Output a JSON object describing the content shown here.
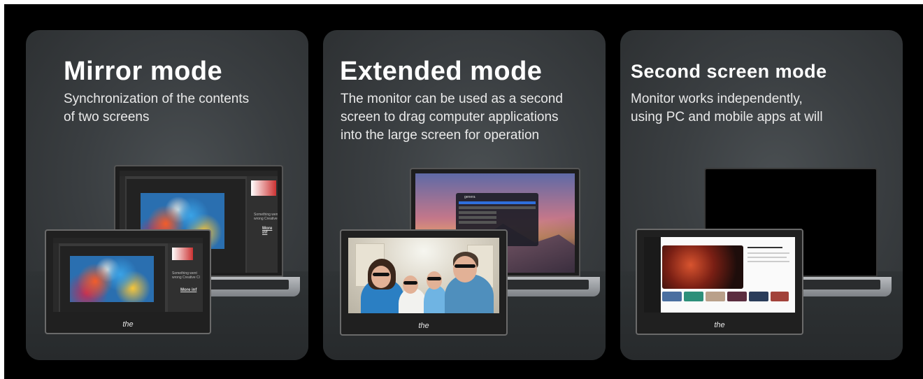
{
  "panels": [
    {
      "title": "Mirror mode",
      "description_line1": "Synchronization of the contents",
      "description_line2": "of two screens",
      "laptop_link": "More inf",
      "monitor_link": "More inf",
      "ps_hint": "Something went wrong Creative Cl",
      "monitor_brand": "the"
    },
    {
      "title": "Extended mode",
      "description_line1": "The monitor can be used as a second",
      "description_line2": "screen to drag computer applications",
      "description_line3": "into the large screen for operation",
      "spotlight_query": "genera",
      "monitor_brand": "the"
    },
    {
      "title": "Second screen mode",
      "description_line1": "Monitor works independently,",
      "description_line2": "using PC and mobile apps at will",
      "monitor_brand": "the"
    }
  ],
  "colors": {
    "background": "#000000",
    "panel": "#3a3e41",
    "title": "#ffffff",
    "description": "#e9e9e9",
    "selection_blue": "#2f6fdc"
  }
}
